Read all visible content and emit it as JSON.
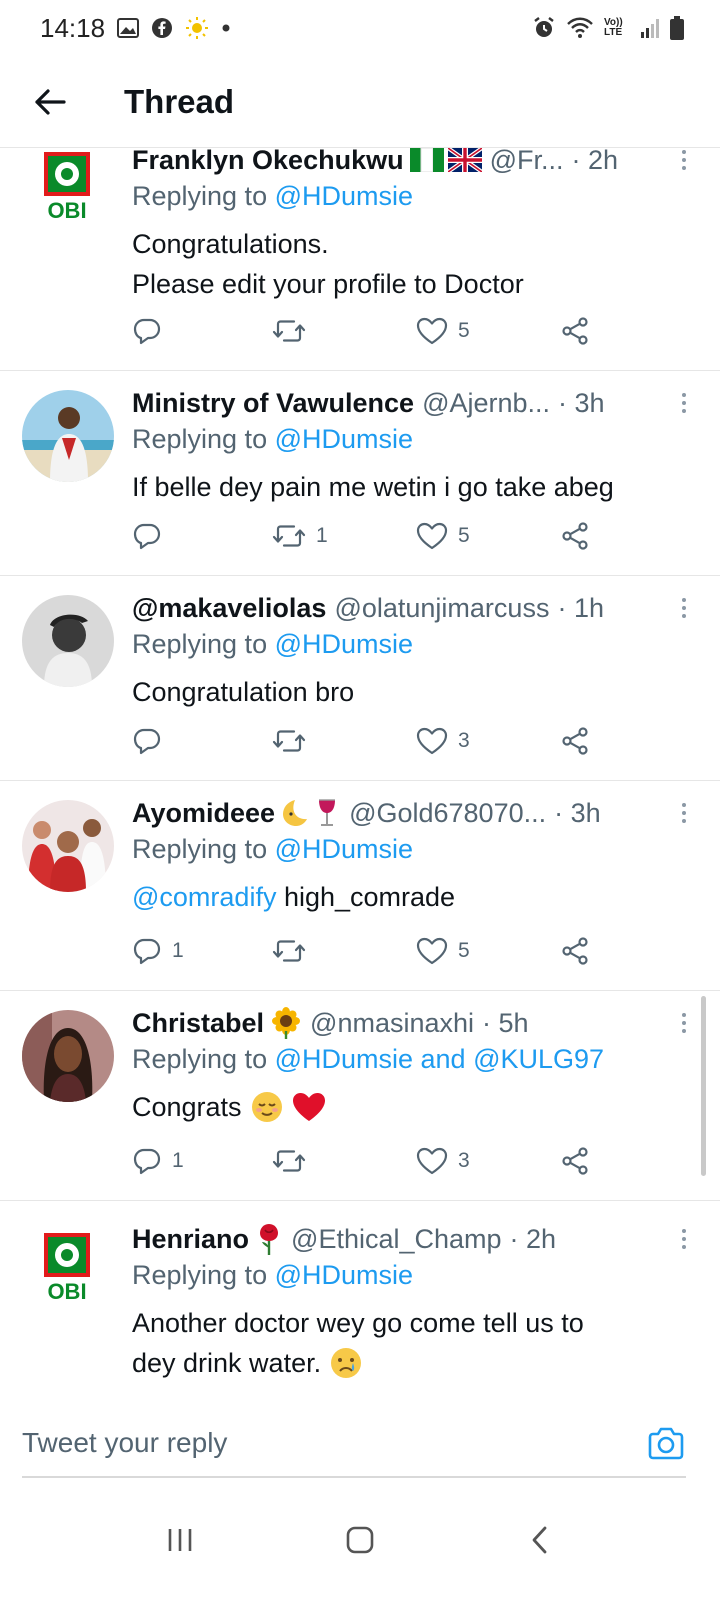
{
  "status_bar": {
    "time": "14:18",
    "network": "Vo)) LTE"
  },
  "header": {
    "title": "Thread"
  },
  "composer": {
    "placeholder": "Tweet your reply"
  },
  "colors": {
    "link": "#1d9bf0",
    "secondary": "#536471",
    "divider": "#e6e6e6",
    "obi_red": "#e21b1b",
    "obi_green": "#0a8a2a"
  },
  "tweets": [
    {
      "name": "Franklyn Okechukwu",
      "emoji": [
        "flag-nigeria",
        "flag-uk"
      ],
      "handle": "@Fr...",
      "time": "· 2h",
      "reply_prefix": "Replying to ",
      "reply_to": "@HDumsie",
      "text_lines": [
        "Congratulations.",
        "Please edit your profile to Doctor"
      ],
      "counts": {
        "reply": "",
        "retweet": "",
        "like": "5"
      },
      "avatar": "obi-logo"
    },
    {
      "name": "Ministry of Vawulence",
      "emoji": [],
      "handle": "@Ajernb...",
      "time": "· 3h",
      "reply_prefix": "Replying to ",
      "reply_to": "@HDumsie",
      "text_lines": [
        "If belle dey pain me wetin i go take abeg"
      ],
      "counts": {
        "reply": "",
        "retweet": "1",
        "like": "5"
      },
      "avatar": "photo-beach"
    },
    {
      "name": "@makaveliolas",
      "emoji": [],
      "handle": "@olatunjimarcuss",
      "time": "· 1h",
      "reply_prefix": "Replying to ",
      "reply_to": "@HDumsie",
      "text_lines": [
        "Congratulation bro"
      ],
      "counts": {
        "reply": "",
        "retweet": "",
        "like": "3"
      },
      "avatar": "photo-bw"
    },
    {
      "name": "Ayomideee",
      "emoji": [
        "moon-face",
        "wine-glass"
      ],
      "handle": "@Gold678070...",
      "time": "· 3h",
      "reply_prefix": "Replying to ",
      "reply_to": "@HDumsie",
      "text_mention": "@comradify",
      "text_rest": " high_comrade",
      "counts": {
        "reply": "1",
        "retweet": "",
        "like": "5"
      },
      "avatar": "photo-team"
    },
    {
      "name": "Christabel",
      "emoji": [
        "sunflower"
      ],
      "handle": "@nmasinaxhi",
      "time": "· 5h",
      "reply_prefix": "Replying to ",
      "reply_to": "@HDumsie and @KULG97",
      "text_lines": [
        "Congrats"
      ],
      "text_emoji": [
        "relieved-face",
        "red-heart"
      ],
      "counts": {
        "reply": "1",
        "retweet": "",
        "like": "3"
      },
      "avatar": "photo-girl"
    },
    {
      "name": "Henriano",
      "emoji": [
        "rose"
      ],
      "handle": "@Ethical_Champ",
      "time": "· 2h",
      "reply_prefix": "Replying to ",
      "reply_to": "@HDumsie",
      "text_lines": [
        "Another doctor wey go come tell us to",
        "dey drink water."
      ],
      "text_emoji": [
        "crying-face"
      ],
      "avatar": "obi-logo"
    }
  ],
  "obi_label": "OBI"
}
